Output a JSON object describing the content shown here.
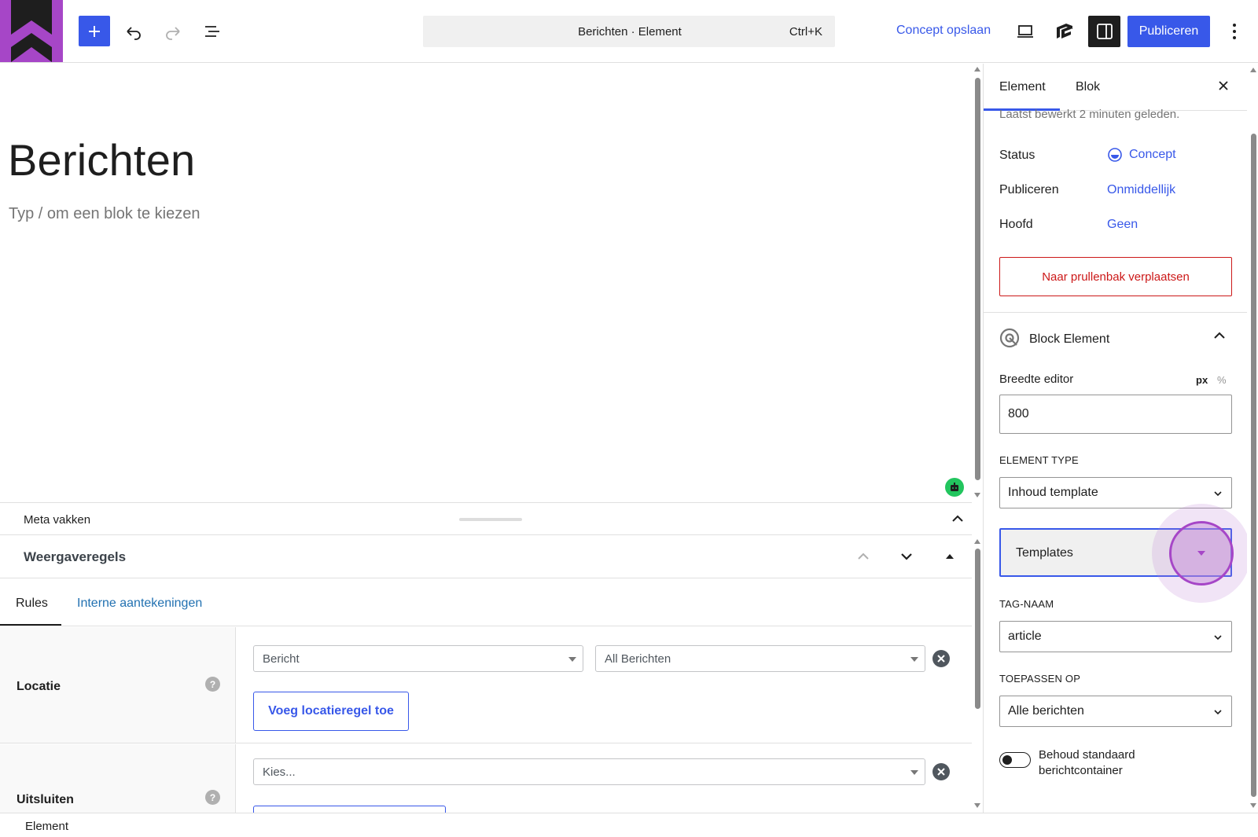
{
  "toolbar": {
    "document_title": "Berichten · Element",
    "shortcut": "Ctrl+K",
    "save_draft": "Concept opslaan",
    "publish": "Publiceren"
  },
  "editor": {
    "title": "Berichten",
    "block_placeholder": "Typ / om een blok te kiezen"
  },
  "meta": {
    "label": "Meta vakken",
    "panel_title": "Weergaveregels",
    "tabs": [
      "Rules",
      "Interne aantekeningen"
    ],
    "location": {
      "label": "Locatie",
      "select1": "Bericht",
      "select2": "All Berichten",
      "add_button": "Voeg locatieregel toe"
    },
    "exclude": {
      "label": "Uitsluiten",
      "select1": "Kies..."
    },
    "help_glyph": "?"
  },
  "footer": {
    "breadcrumb": "Element"
  },
  "sidebar": {
    "tabs": [
      "Element",
      "Blok"
    ],
    "last_edited": "Laatst bewerkt 2 minuten geleden.",
    "rows": [
      {
        "label": "Status",
        "value": "Concept"
      },
      {
        "label": "Publiceren",
        "value": "Onmiddellijk"
      },
      {
        "label": "Hoofd",
        "value": "Geen"
      }
    ],
    "trash": "Naar prullenbak verplaatsen",
    "block_element": {
      "title": "Block Element",
      "width_label": "Breedte editor",
      "unit_px": "px",
      "unit_pct": "%",
      "width_value": "800",
      "element_type_label": "ELEMENT TYPE",
      "element_type_value": "Inhoud template",
      "templates_label": "Templates",
      "tag_label": "TAG-NAAM",
      "tag_value": "article",
      "apply_label": "TOEPASSEN OP",
      "apply_value": "Alle berichten",
      "toggle_label": "Behoud standaard berichtcontainer"
    }
  },
  "colors": {
    "accent": "#3858e9",
    "logo_purple": "#a646c7",
    "danger": "#cc1818",
    "highlight": "#c084d6"
  }
}
